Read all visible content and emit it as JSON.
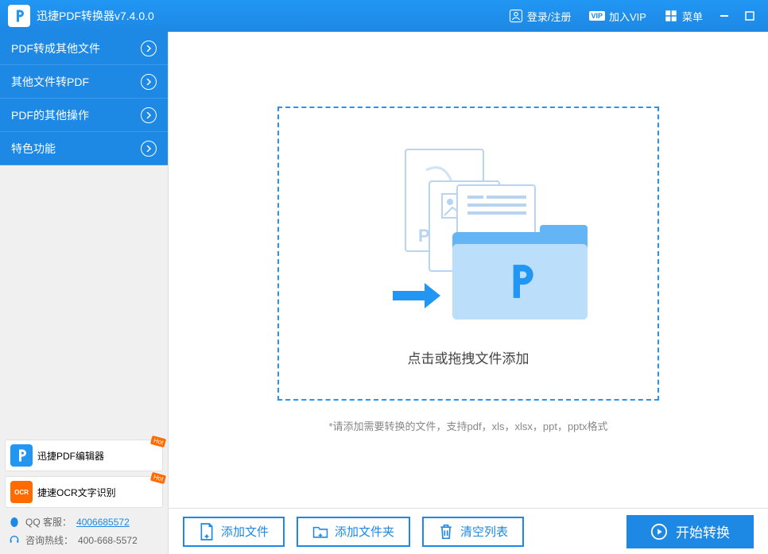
{
  "app": {
    "title": "迅捷PDF转换器v7.4.0.0"
  },
  "titlebar": {
    "login": "登录/注册",
    "vip": "加入VIP",
    "vip_badge": "VIP",
    "menu": "菜单"
  },
  "sidebar": {
    "items": [
      {
        "label": "PDF转成其他文件"
      },
      {
        "label": "其他文件转PDF"
      },
      {
        "label": "PDF的其他操作"
      },
      {
        "label": "特色功能"
      }
    ],
    "promos": [
      {
        "label": "迅捷PDF编辑器",
        "badge": "Hot"
      },
      {
        "label": "捷速OCR文字识别",
        "badge": "Hot",
        "icon_text": "OCR"
      }
    ],
    "support": {
      "qq_label": "QQ 客服：",
      "qq_number": "4006685572",
      "hotline_label": "咨询热线：",
      "hotline_number": "400-668-5572"
    }
  },
  "main": {
    "dropzone_text": "点击或拖拽文件添加",
    "hint_text": "*请添加需要转换的文件，支持pdf，xls，xlsx，ppt，pptx格式"
  },
  "actions": {
    "add_file": "添加文件",
    "add_folder": "添加文件夹",
    "clear_list": "清空列表",
    "start": "开始转换"
  }
}
